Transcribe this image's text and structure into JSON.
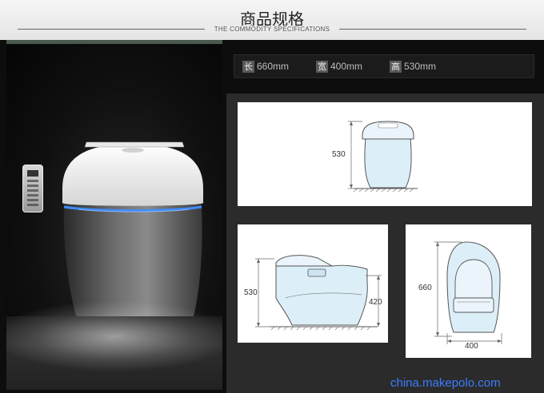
{
  "header": {
    "title": "商品规格",
    "subtitle": "THE COMMODITY SPECIFICATIONS"
  },
  "specs": [
    {
      "label": "长",
      "value": "660",
      "unit": "mm"
    },
    {
      "label": "宽",
      "value": "400",
      "unit": "mm"
    },
    {
      "label": "高",
      "value": "530",
      "unit": "mm"
    }
  ],
  "diagrams": {
    "front": {
      "height": "530"
    },
    "side": {
      "height": "530",
      "seat_height": "420"
    },
    "top": {
      "length": "660",
      "width": "400"
    }
  },
  "watermark": "china.makepolo.com",
  "colors": {
    "background": "#0d0d0d",
    "header": "#eeeeee",
    "blue_light": "#3f8cff",
    "diagram_fill": "#dceef8"
  }
}
